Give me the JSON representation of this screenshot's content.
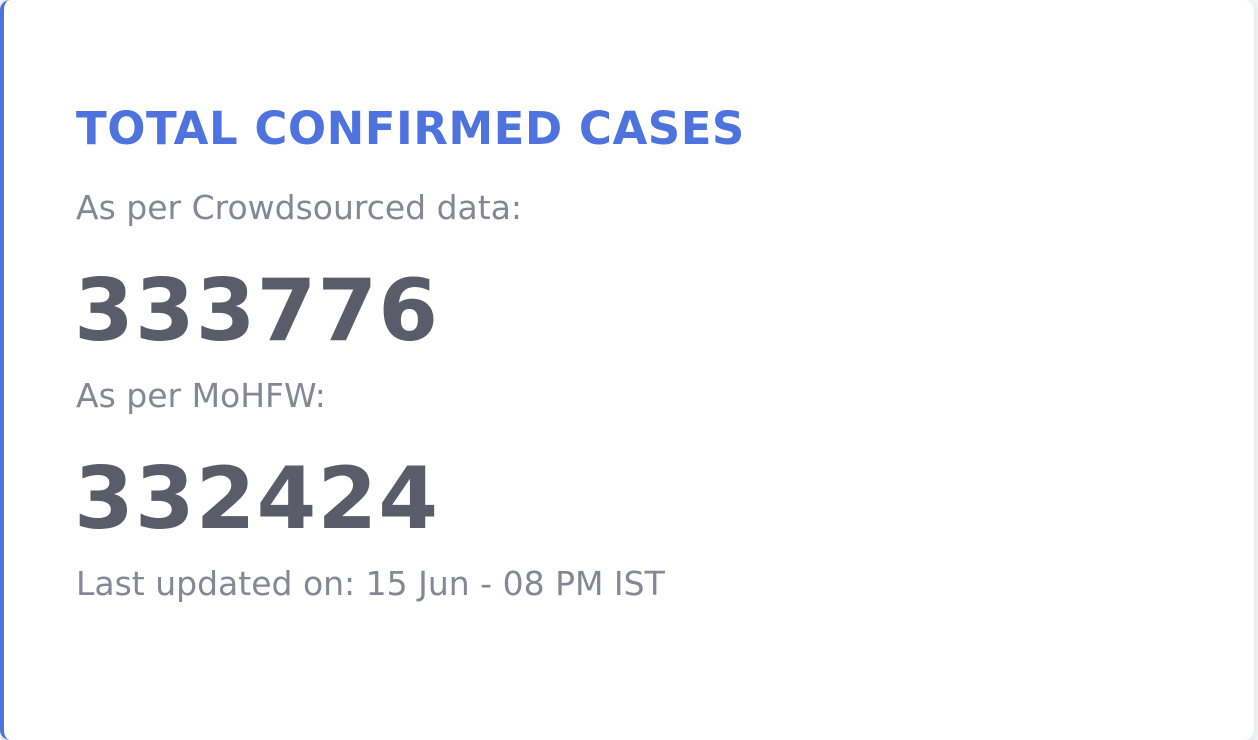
{
  "card": {
    "title": "TOTAL CONFIRMED CASES",
    "crowdsourced_label": "As per Crowdsourced data:",
    "crowdsourced_value": "333776",
    "mohfw_label": "As per MoHFW:",
    "mohfw_value": "332424",
    "last_updated": "Last updated on: 15 Jun - 08 PM IST"
  },
  "colors": {
    "accent": "#4e73df",
    "value_text": "#5a5c69",
    "label_text": "#858796",
    "card_background": "#ffffff"
  }
}
